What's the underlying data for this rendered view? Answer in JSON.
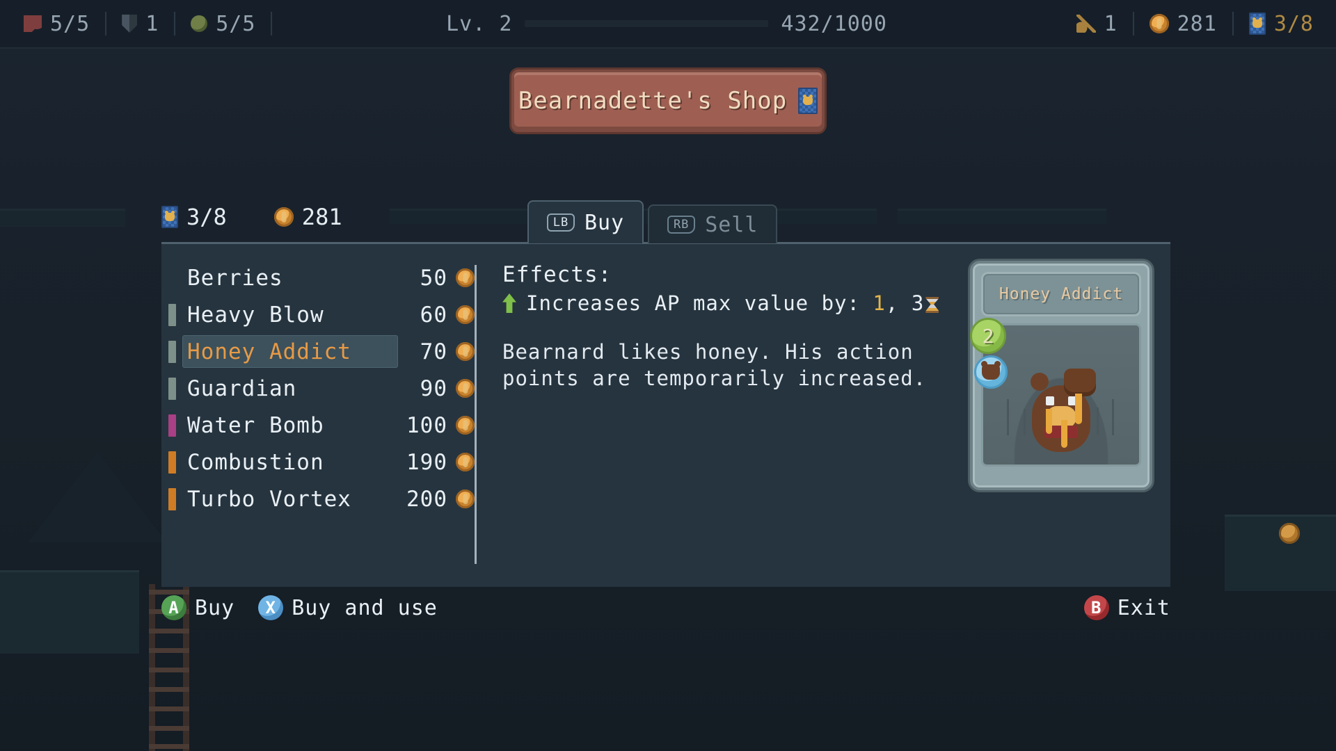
{
  "hud": {
    "health": {
      "icon": "heart-icon",
      "value": "5/5"
    },
    "armor": {
      "icon": "shield-icon",
      "value": "1"
    },
    "stamina": {
      "icon": "orb-icon",
      "value": "5/5"
    },
    "level_label": "Lv. 2",
    "xp_text": "432/1000",
    "xp_current": 432,
    "xp_max": 1000,
    "keys": {
      "icon": "key-icon",
      "value": "1"
    },
    "coins": {
      "icon": "coin-icon",
      "value": "281"
    },
    "cards": {
      "icon": "card-icon",
      "value": "3/8"
    }
  },
  "banner": {
    "title": "Bearnadette's Shop",
    "icon": "card-icon"
  },
  "currency": {
    "cards_icon": "card-icon",
    "cards_value": "3/8",
    "coin_icon": "coin-icon",
    "coin_value": "281"
  },
  "tabs": [
    {
      "button": "LB",
      "label": "Buy",
      "active": true
    },
    {
      "button": "RB",
      "label": "Sell",
      "active": false
    }
  ],
  "items": [
    {
      "name": "Berries",
      "price": "50",
      "chip": "none",
      "selected": false
    },
    {
      "name": "Heavy Blow",
      "price": "60",
      "chip": "#7d9089",
      "selected": false
    },
    {
      "name": "Honey Addict",
      "price": "70",
      "chip": "#7d9089",
      "selected": true
    },
    {
      "name": "Guardian",
      "price": "90",
      "chip": "#7d9089",
      "selected": false
    },
    {
      "name": "Water Bomb",
      "price": "100",
      "chip": "#a93f84",
      "selected": false
    },
    {
      "name": "Combustion",
      "price": "190",
      "chip": "#cf7c25",
      "selected": false
    },
    {
      "name": "Turbo Vortex",
      "price": "200",
      "chip": "#cf7c25",
      "selected": false
    }
  ],
  "details": {
    "effects_heading": "Effects:",
    "effect_prefix": "Increases AP max value by:",
    "effect_amount": "1",
    "effect_duration": "3",
    "description": "Bearnard likes honey. His action points are temporarily increased."
  },
  "card": {
    "title": "Honey Addict",
    "cost": "2",
    "type_icon": "bear-face-icon"
  },
  "actions": [
    {
      "button": "A",
      "label": "Buy"
    },
    {
      "button": "X",
      "label": "Buy and use"
    },
    {
      "button": "B",
      "label": "Exit"
    }
  ],
  "colors": {
    "panel_bg": "#26343f",
    "selected_row_bg": "#3c515c",
    "selected_text": "#e89a45",
    "banner_bg": "#9e5f52",
    "gold": "#e3b64a",
    "green": "#7fbf4a"
  }
}
